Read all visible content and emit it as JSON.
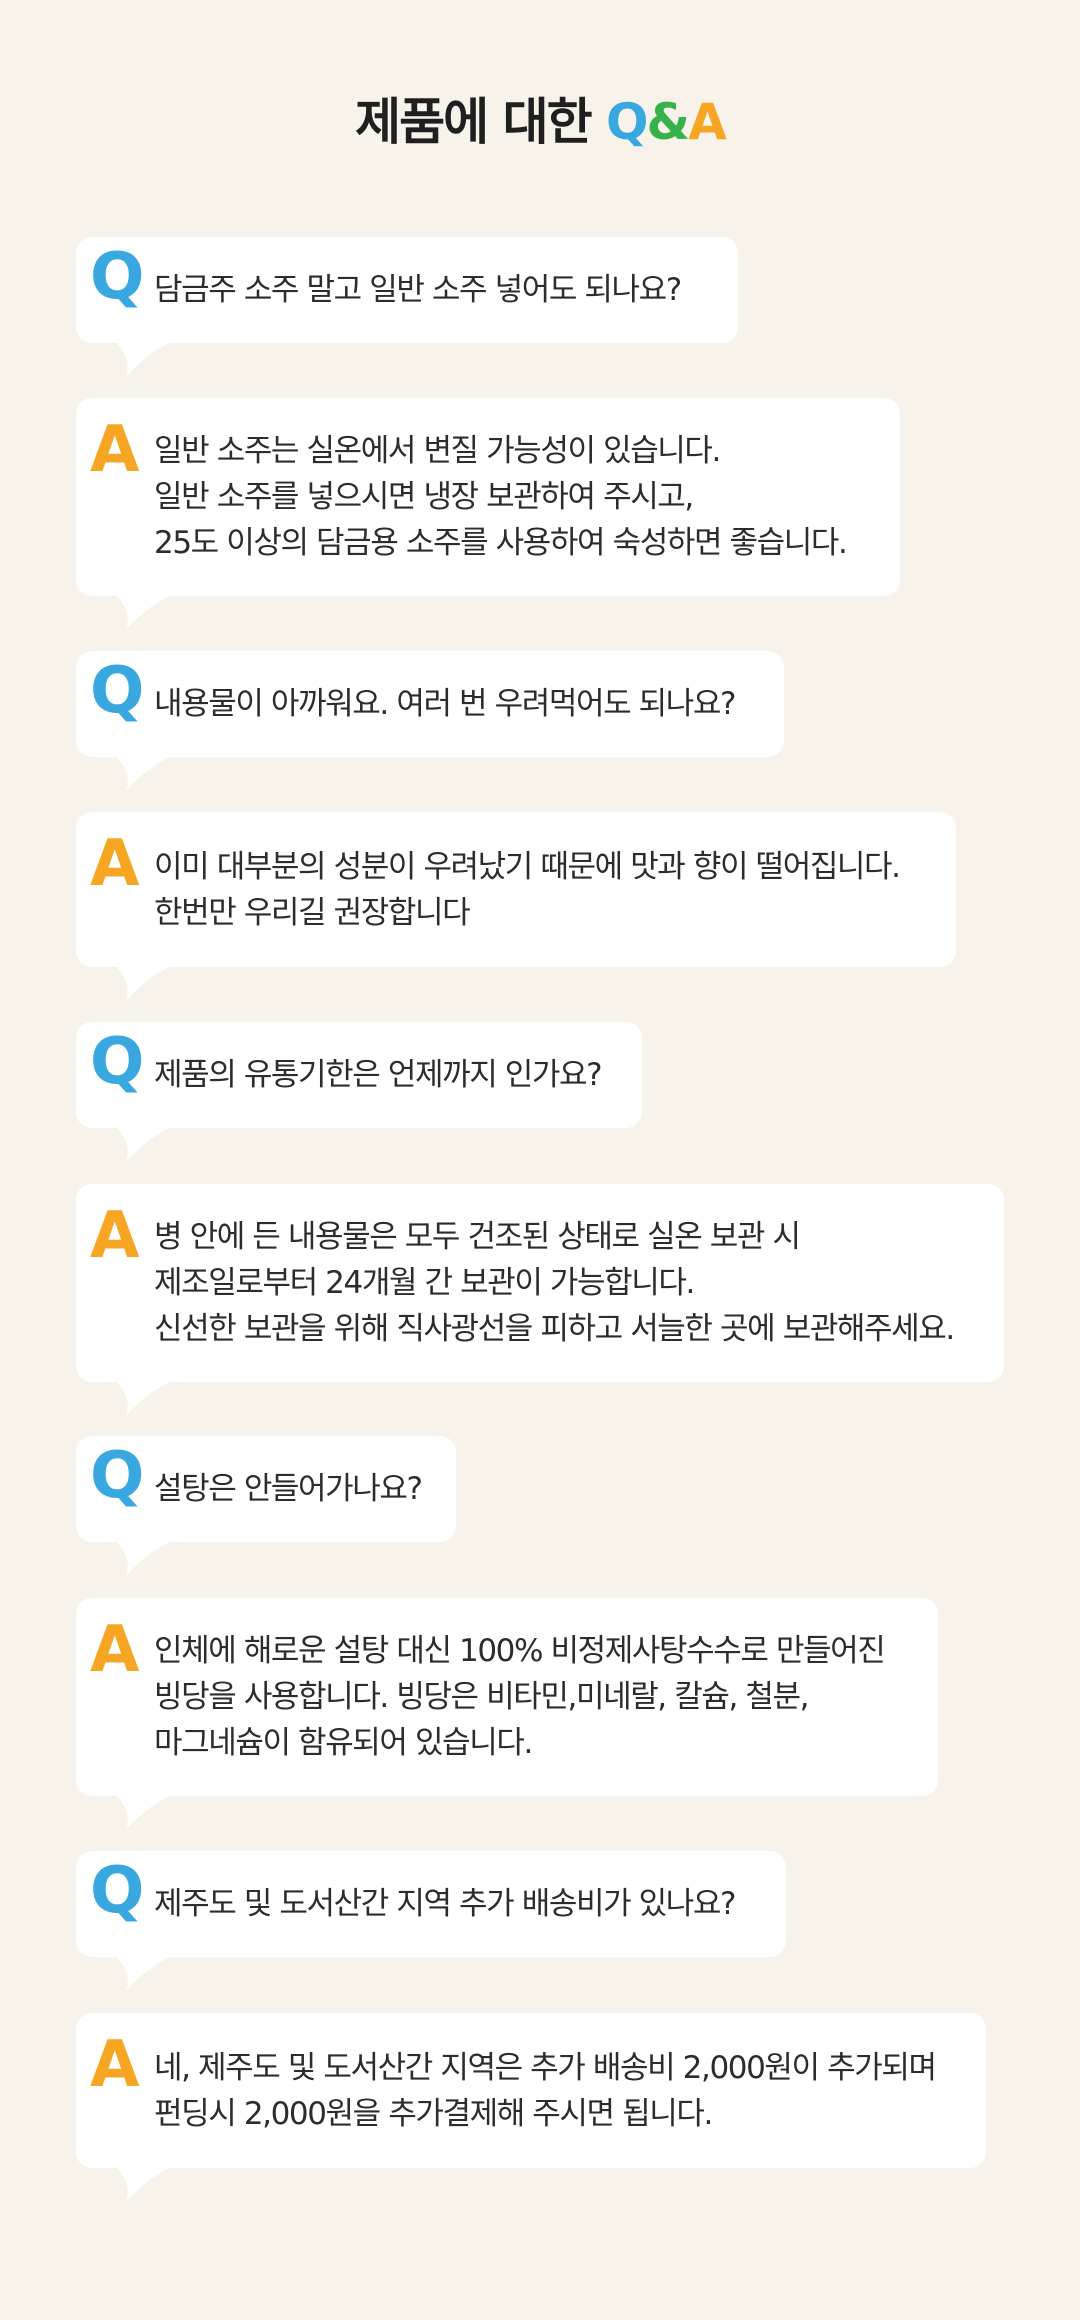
{
  "title": {
    "main": "제품에 대한 ",
    "q": "Q",
    "amp": "&",
    "a": "A"
  },
  "labels": {
    "q": "Q",
    "a": "A"
  },
  "qa": [
    {
      "q": "담금주 소주 말고 일반 소주 넣어도 되나요?",
      "a": [
        "일반 소주는 실온에서 변질 가능성이 있습니다.",
        "일반 소주를 넣으시면 냉장 보관하여 주시고,",
        "25도 이상의 담금용 소주를 사용하여 숙성하면 좋습니다."
      ]
    },
    {
      "q": "내용물이 아까워요. 여러 번 우려먹어도 되나요?",
      "a": [
        "이미 대부분의 성분이 우려났기 때문에 맛과 향이 떨어집니다.",
        "한번만 우리길 권장합니다"
      ]
    },
    {
      "q": "제품의 유통기한은 언제까지 인가요?",
      "a": [
        "병 안에 든 내용물은 모두 건조된 상태로 실온 보관 시",
        "제조일로부터 24개월 간 보관이 가능합니다.",
        "신선한 보관을 위해 직사광선을 피하고 서늘한 곳에 보관해주세요."
      ]
    },
    {
      "q": "설탕은 안들어가나요?",
      "a": [
        "인체에 해로운 설탕 대신 100% 비정제사탕수수로 만들어진",
        "빙당을 사용합니다. 빙당은 비타민,미네랄, 칼슘, 철분,",
        "마그네슘이 함유되어 있습니다."
      ]
    },
    {
      "q": "제주도 및 도서산간 지역 추가 배송비가 있나요?",
      "a": [
        "네, 제주도 및 도서산간 지역은 추가 배송비 2,000원이 추가되며",
        "펀딩시 2,000원을 추가결제해 주시면 됩니다."
      ]
    }
  ]
}
